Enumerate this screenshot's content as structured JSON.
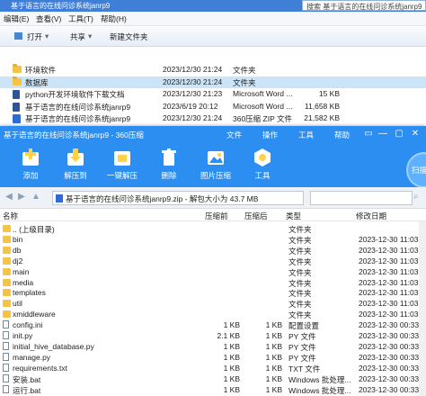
{
  "explorer": {
    "title": "基于语言的在线问诊系统janrp9",
    "search_placeholder": "搜索 基于语言的在线问诊系统janrp9",
    "menu": [
      "编辑(E)",
      "查看(V)",
      "工具(T)",
      "帮助(H)"
    ],
    "toolbar": {
      "open": "打开",
      "share": "共享",
      "new_folder": "新建文件夹"
    },
    "files": [
      {
        "name": "环境软件",
        "date": "2023/12/30 21:24",
        "type": "文件夹",
        "size": "",
        "icon": "folder"
      },
      {
        "name": "数据库",
        "date": "2023/12/30 21:24",
        "type": "文件夹",
        "size": "",
        "icon": "folder"
      },
      {
        "name": "python开发环境软件下载文档",
        "date": "2023/12/30 21:23",
        "type": "Microsoft Word ...",
        "size": "15 KB",
        "icon": "word"
      },
      {
        "name": "基于语言的在线问诊系统janrp9",
        "date": "2023/6/19 20:12",
        "type": "Microsoft Word ...",
        "size": "11,658 KB",
        "icon": "word"
      },
      {
        "name": "基于语言的在线问诊系统janrp9",
        "date": "2023/12/30 21:24",
        "type": "360压缩 ZIP 文件",
        "size": "21,582 KB",
        "icon": "zip"
      }
    ]
  },
  "zip": {
    "title": "基于语言的在线问诊系统janrp9 - 360压缩",
    "menu": [
      "文件",
      "操作",
      "工具",
      "帮助"
    ],
    "window_buttons": [
      "▭",
      "—",
      "▢",
      "✕"
    ],
    "ribbon": [
      {
        "label": "添加",
        "icon": "add-icon"
      },
      {
        "label": "解压到",
        "icon": "extract-to-icon"
      },
      {
        "label": "一键解压",
        "icon": "one-click-extract-icon"
      },
      {
        "label": "删除",
        "icon": "delete-icon"
      },
      {
        "label": "图片压缩",
        "icon": "image-compress-icon"
      },
      {
        "label": "工具",
        "icon": "tools-icon"
      }
    ],
    "scan_label": "扫描",
    "path": "基于语言的在线问诊系统janrp9.zip - 解包大小为 43.7 MB",
    "columns": {
      "name": "名称",
      "packed": "压缩前",
      "size": "压缩后",
      "type": "类型",
      "modified": "修改日期"
    },
    "rows": [
      {
        "name": ".. (上级目录)",
        "packed": "",
        "size": "",
        "type": "文件夹",
        "modified": "",
        "icon": "folder"
      },
      {
        "name": "bin",
        "packed": "",
        "size": "",
        "type": "文件夹",
        "modified": "2023-12-30 11:03",
        "icon": "folder"
      },
      {
        "name": "db",
        "packed": "",
        "size": "",
        "type": "文件夹",
        "modified": "2023-12-30 11:03",
        "icon": "folder"
      },
      {
        "name": "dj2",
        "packed": "",
        "size": "",
        "type": "文件夹",
        "modified": "2023-12-30 11:03",
        "icon": "folder"
      },
      {
        "name": "main",
        "packed": "",
        "size": "",
        "type": "文件夹",
        "modified": "2023-12-30 11:03",
        "icon": "folder"
      },
      {
        "name": "media",
        "packed": "",
        "size": "",
        "type": "文件夹",
        "modified": "2023-12-30 11:03",
        "icon": "folder"
      },
      {
        "name": "templates",
        "packed": "",
        "size": "",
        "type": "文件夹",
        "modified": "2023-12-30 11:03",
        "icon": "folder"
      },
      {
        "name": "util",
        "packed": "",
        "size": "",
        "type": "文件夹",
        "modified": "2023-12-30 11:03",
        "icon": "folder"
      },
      {
        "name": "xmiddleware",
        "packed": "",
        "size": "",
        "type": "文件夹",
        "modified": "2023-12-30 11:03",
        "icon": "folder"
      },
      {
        "name": "config.ini",
        "packed": "1 KB",
        "size": "1 KB",
        "type": "配置设置",
        "modified": "2023-12-30 00:33",
        "icon": "file"
      },
      {
        "name": "init.py",
        "packed": "2.1 KB",
        "size": "1 KB",
        "type": "PY 文件",
        "modified": "2023-12-30 00:33",
        "icon": "file"
      },
      {
        "name": "initial_hive_database.py",
        "packed": "1 KB",
        "size": "1 KB",
        "type": "PY 文件",
        "modified": "2023-12-30 00:33",
        "icon": "file"
      },
      {
        "name": "manage.py",
        "packed": "1 KB",
        "size": "1 KB",
        "type": "PY 文件",
        "modified": "2023-12-30 00:33",
        "icon": "file"
      },
      {
        "name": "requirements.txt",
        "packed": "1 KB",
        "size": "1 KB",
        "type": "TXT 文件",
        "modified": "2023-12-30 00:33",
        "icon": "file"
      },
      {
        "name": "安装.bat",
        "packed": "1 KB",
        "size": "1 KB",
        "type": "Windows 批处理...",
        "modified": "2023-12-30 00:33",
        "icon": "file"
      },
      {
        "name": "运行.bat",
        "packed": "1 KB",
        "size": "1 KB",
        "type": "Windows 批处理...",
        "modified": "2023-12-30 00:33",
        "icon": "file"
      }
    ]
  },
  "colors": {
    "accent": "#2c8ef0",
    "folder": "#f4c442",
    "selection": "#cce4f7"
  }
}
